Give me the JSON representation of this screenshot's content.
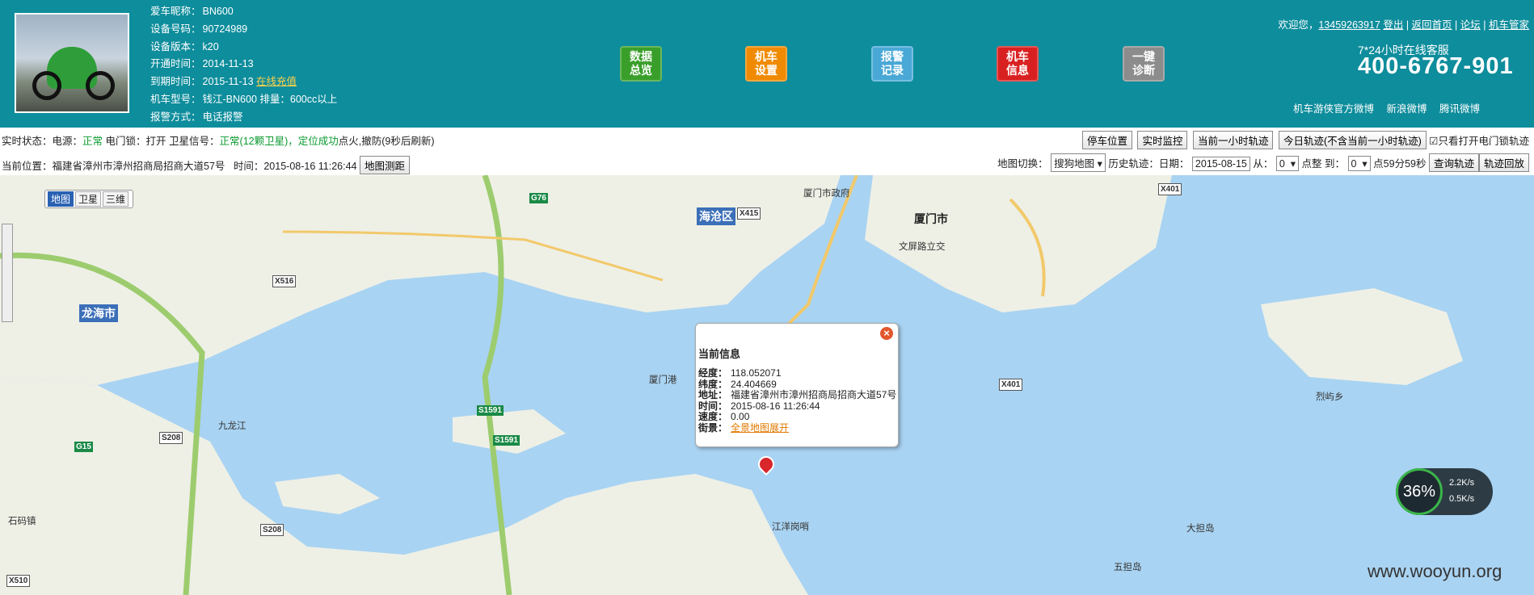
{
  "header": {
    "info": [
      {
        "label": "爱车昵称：",
        "value": "BN600"
      },
      {
        "label": "设备号码：",
        "value": "90724989"
      },
      {
        "label": "设备版本：",
        "value": "k20"
      },
      {
        "label": "开通时间：",
        "value": "2014-11-13"
      },
      {
        "label": "到期时间：",
        "value": "2015-11-13",
        "link": "在线充值"
      },
      {
        "label": "机车型号：",
        "value": "钱江-BN600 排量：600cc以上"
      },
      {
        "label": "报警方式：",
        "value": "电话报警"
      }
    ],
    "nav": [
      {
        "line1": "数据",
        "line2": "总览",
        "color": "#3a9f2a"
      },
      {
        "line1": "机车",
        "line2": "设置",
        "color": "#f08a00"
      },
      {
        "line1": "报警",
        "line2": "记录",
        "color": "#4aa8d6"
      },
      {
        "line1": "机车",
        "line2": "信息",
        "color": "#d92020"
      },
      {
        "line1": "一键",
        "line2": "诊断",
        "color": "#8c8c8c"
      }
    ],
    "welcome": "欢迎您，",
    "user": "13459263917",
    "logout": "登出",
    "home": "返回首页",
    "forum": "论坛",
    "manager": "机车管家",
    "hotline_label": "7*24小时在线客服",
    "hotline": "400-6767-901",
    "weibo_label": "机车游侠官方微博",
    "sina": "新浪微博",
    "tencent": "腾讯微博"
  },
  "status": {
    "prefix": "实时状态：电源：",
    "power": "正常",
    "door": "电门锁：打开",
    "sat_label": "卫星信号：",
    "sat": "正常(12颗卫星)",
    "locate": "，定位成功",
    "rest": "点火,撤防(9秒后刷新)",
    "position_label": "当前位置：",
    "position": "福建省漳州市漳州招商局招商大道57号",
    "time_label": "时间：",
    "time": "2015-08-16 11:26:44",
    "measure": "地图测距"
  },
  "toolbar": {
    "park": "停车位置",
    "monitor": "实时监控",
    "last_hour": "当前一小时轨迹",
    "today": "今日轨迹(不含当前一小时轨迹)",
    "only_door": "只看打开电门锁轨迹",
    "map_switch": "地图切换：",
    "map_select": "搜狗地图",
    "history": "历史轨迹：日期：",
    "date": "2015-08-15",
    "from": "从：",
    "from_val": "0",
    "hour1": "点整 到：",
    "to_val": "0",
    "hour2": "点59分59秒",
    "query": "查询轨迹",
    "replay": "轨迹回放"
  },
  "map": {
    "types": [
      "地图",
      "卫星",
      "三维"
    ],
    "labels": [
      {
        "t": "厦门市"
      },
      {
        "t": "海沧区"
      },
      {
        "t": "龙海市"
      },
      {
        "t": "厦门港"
      },
      {
        "t": "九龙江"
      },
      {
        "t": "大担岛"
      },
      {
        "t": "五担岛"
      },
      {
        "t": "文屏路立交"
      },
      {
        "t": "厦门市政府"
      },
      {
        "t": "石码镇"
      },
      {
        "t": "江洋岗哨"
      },
      {
        "t": "烈屿乡"
      }
    ],
    "roads": [
      "G76",
      "X415",
      "X516",
      "S1591",
      "S1591",
      "G15",
      "S208",
      "S208",
      "X401",
      "X401",
      "X510"
    ]
  },
  "popup": {
    "title": "当前信息",
    "rows": [
      {
        "k": "经度：",
        "v": "118.052071"
      },
      {
        "k": "纬度：",
        "v": "24.404669"
      },
      {
        "k": "地址：",
        "v": "福建省漳州市漳州招商局招商大道57号"
      },
      {
        "k": "时间：",
        "v": "2015-08-16 11:26:44"
      },
      {
        "k": "速度：",
        "v": "0.00"
      },
      {
        "k": "街景：",
        "v": "全景地图展开"
      }
    ]
  },
  "speed_widget": {
    "percent": "36%",
    "up": "2.2K/s",
    "down": "0.5K/s"
  },
  "watermark": "www.wooyun.org"
}
